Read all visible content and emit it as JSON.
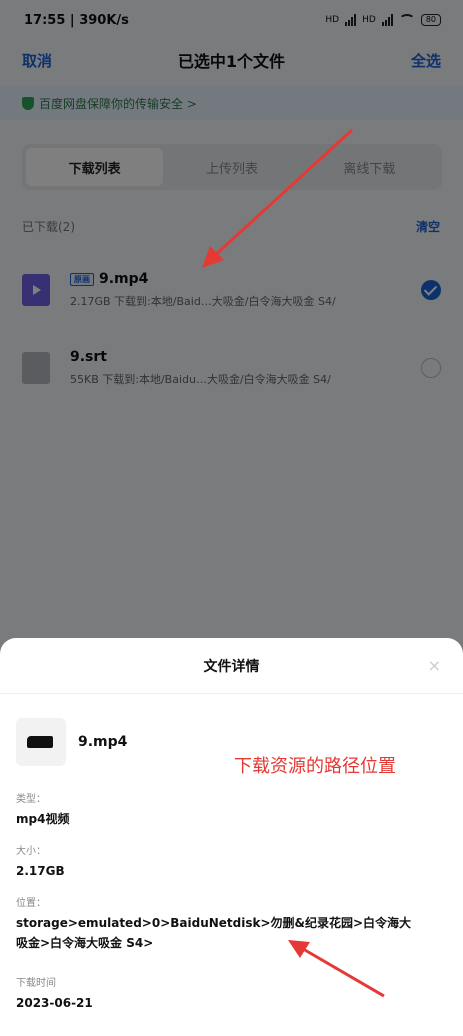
{
  "status_bar": {
    "time": "17:55",
    "speed": "390K/s",
    "net1": "HD",
    "net2": "HD",
    "battery": "80"
  },
  "header": {
    "cancel_label": "取消",
    "title": "已选中1个文件",
    "select_all_label": "全选"
  },
  "security_banner": {
    "text": "百度网盘保障你的传输安全 >"
  },
  "tabs": [
    {
      "label": "下载列表",
      "active": true
    },
    {
      "label": "上传列表",
      "active": false
    },
    {
      "label": "离线下载",
      "active": false
    }
  ],
  "section": {
    "count_label": "已下载(2)",
    "clear_label": "清空"
  },
  "files": [
    {
      "badge": "原画",
      "name": "9.mp4",
      "meta": "2.17GB  下载到:本地/Baid…大吸金/白令海大吸金 S4/",
      "selected": true,
      "icon": "video-file-icon"
    },
    {
      "badge": "",
      "name": "9.srt",
      "meta": "55KB  下载到:本地/Baidu…大吸金/白令海大吸金 S4/",
      "selected": false,
      "icon": "document-file-icon"
    }
  ],
  "sheet": {
    "title": "文件详情",
    "close_label": "×",
    "file_name": "9.mp4",
    "annotation": "下载资源的路径位置",
    "type_label": "类型：",
    "type_value": "mp4视频",
    "size_label": "大小：",
    "size_value": "2.17GB",
    "location_label": "位置：",
    "location_value": "storage>emulated>0>BaiduNetdisk>勿删&纪录花园>白令海大吸金>白令海大吸金 S4>",
    "time_label": "下载时间",
    "time_value": "2023-06-21"
  },
  "colors": {
    "accent": "#1a62d6",
    "annotation": "#e53935",
    "video_icon": "#6e63e8"
  }
}
